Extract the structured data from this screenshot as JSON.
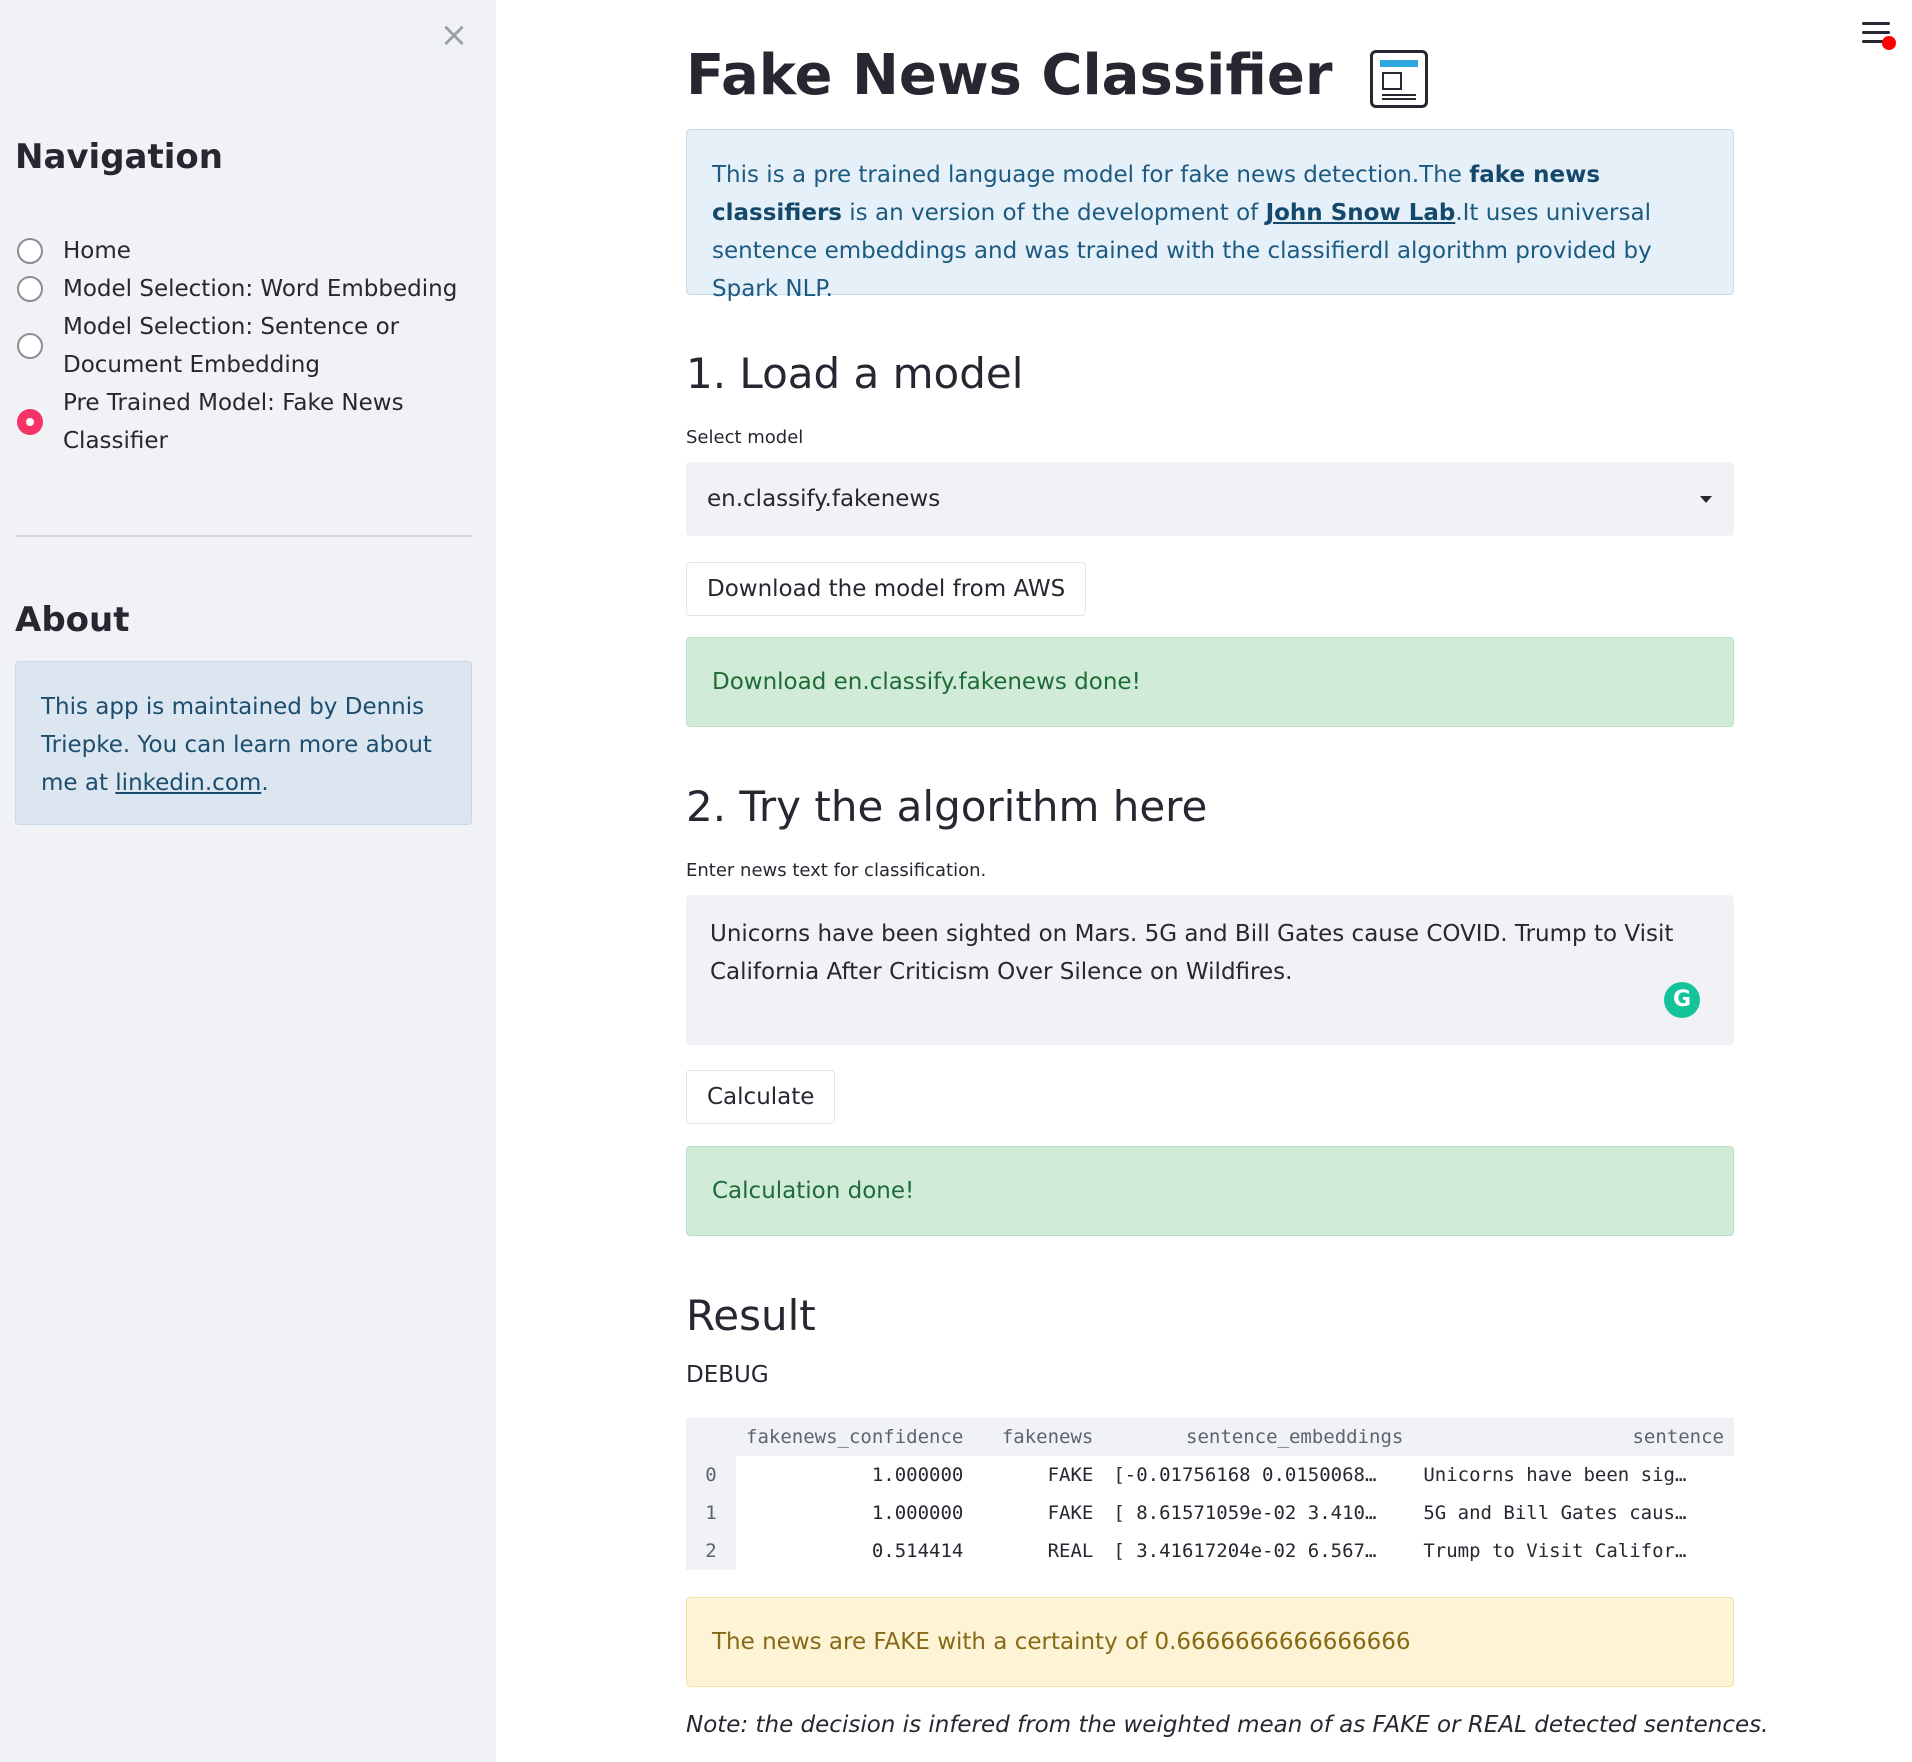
{
  "sidebar": {
    "close_label": "×",
    "nav_title": "Navigation",
    "nav_items": [
      {
        "label_lines": [
          "Home"
        ],
        "selected": false
      },
      {
        "label_lines": [
          "Model Selection: Word Embbeding"
        ],
        "selected": false
      },
      {
        "label_lines": [
          "Model Selection: Sentence or",
          "Document Embedding"
        ],
        "selected": false
      },
      {
        "label_lines": [
          "Pre Trained Model: Fake News",
          "Classifier"
        ],
        "selected": true
      }
    ],
    "about_title": "About",
    "about_text_1": "This app is maintained by Dennis Triepke. You can learn more about me at ",
    "about_link": "linkedin.com",
    "about_text_2": "."
  },
  "main": {
    "title": "Fake News Classifier",
    "title_icon": "newspaper-icon",
    "info": {
      "t1": "This is a pre trained language model for fake news detection.The ",
      "bold": "fake news classifiers",
      "t2": " is an version of the development of ",
      "link": "John Snow Lab",
      "t3": ".It uses universal sentence embeddings and was trained with the classifierdl algorithm provided by Spark NLP."
    },
    "section1": "1. Load a model",
    "select_label": "Select model",
    "select_value": "en.classify.fakenews",
    "download_button": "Download the model from AWS",
    "download_success": "Download en.classify.fakenews done!",
    "section2": "2. Try the algorithm here",
    "textarea_label": "Enter news text for classification.",
    "textarea_value": "Unicorns have been sighted on Mars. 5G and Bill Gates cause COVID. Trump to Visit California After Criticism Over Silence on Wildfires.",
    "calculate_button": "Calculate",
    "calc_success": "Calculation done!",
    "result_title": "Result",
    "debug_label": "DEBUG",
    "table": {
      "columns": [
        "",
        "fakenews_confidence",
        "fakenews",
        "sentence_embeddings",
        "sentence"
      ],
      "rows": [
        [
          "0",
          "1.000000",
          "FAKE",
          "[-0.01756168 0.0150068…",
          "Unicorns have been sig…"
        ],
        [
          "1",
          "1.000000",
          "FAKE",
          "[ 8.61571059e-02 3.410…",
          "5G and Bill Gates caus…"
        ],
        [
          "2",
          "0.514414",
          "REAL",
          "[ 3.41617204e-02 6.567…",
          "Trump to Visit Califor…"
        ]
      ]
    },
    "warning": "The news are FAKE with a certainty of 0.6666666666666666",
    "note": "Note: the decision is infered from the weighted mean of as FAKE or REAL detected sentences."
  },
  "colors": {
    "accent": "#f63366",
    "sidebar_bg": "#f0f2f6",
    "info_bg": "#e6f0f8",
    "success_bg": "#d0ecd9",
    "warning_bg": "#fdf3d5"
  }
}
